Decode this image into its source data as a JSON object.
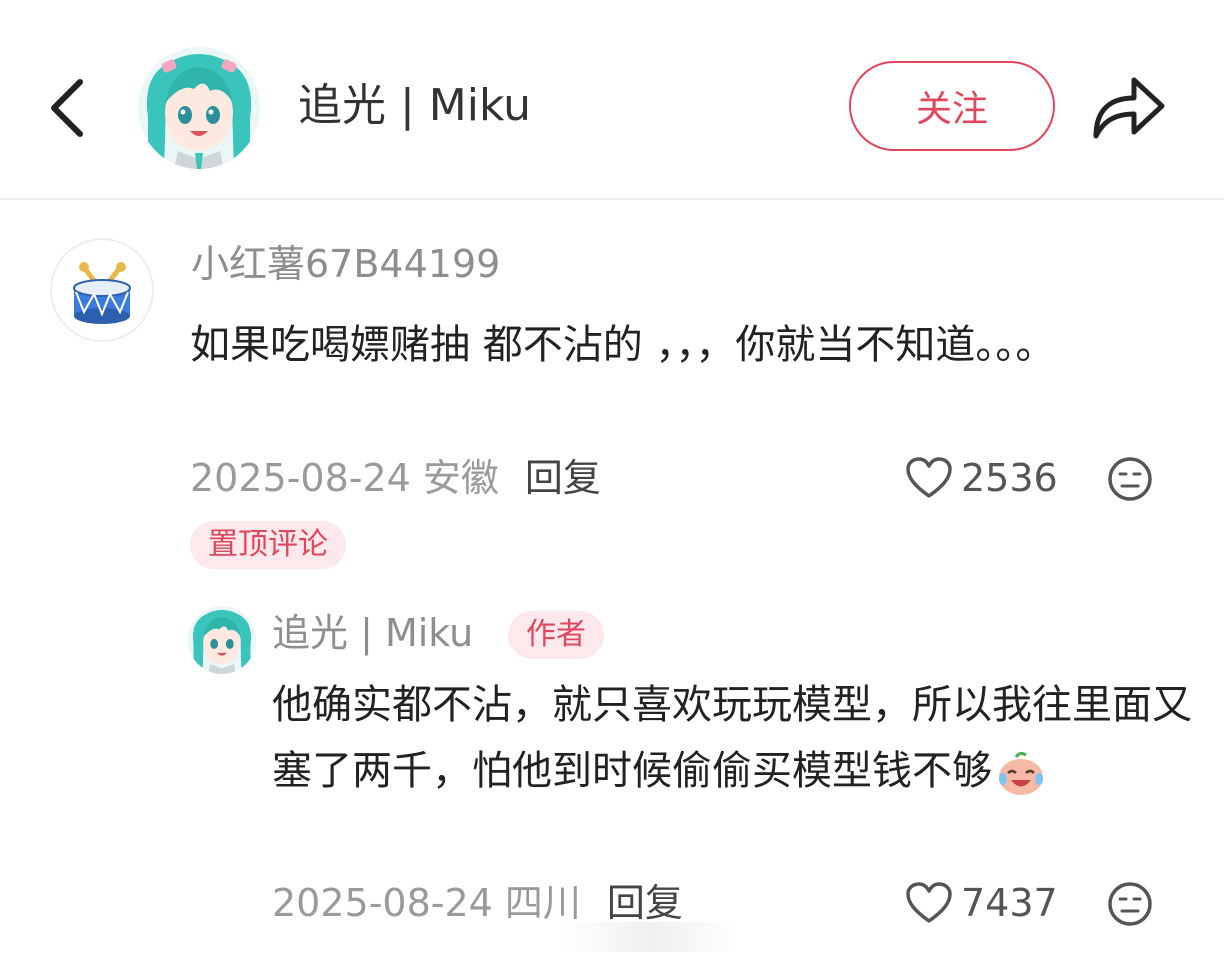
{
  "header": {
    "title": "追光 | Miku",
    "follow_label": "关注"
  },
  "comment": {
    "username": "小红薯67B44199",
    "text": "如果吃喝嫖赌抽 都不沾的 ，，，你就当不知道。。。",
    "date_location": "2025-08-24 安徽",
    "reply_label": "回复",
    "likes": "2536",
    "pinned_label": "置顶评论"
  },
  "reply": {
    "username": "追光 | Miku",
    "author_label": "作者",
    "text": "他确实都不沾，就只喜欢玩玩模型，所以我往里面又塞了两千，怕他到时候偷偷买模型钱不够",
    "date_location": "2025-08-24 四川",
    "reply_label": "回复",
    "likes": "7437"
  },
  "icons": {
    "back": "chevron-left-icon",
    "share": "share-arrow-icon",
    "like": "heart-outline-icon",
    "dislike": "neutral-face-icon",
    "emoji": "crying-laughing-peach-emoji"
  },
  "colors": {
    "accent": "#e0475c",
    "badge_bg": "#fde8ec",
    "muted_text": "#8e8e8e",
    "miku_teal": "#39c5bb"
  }
}
